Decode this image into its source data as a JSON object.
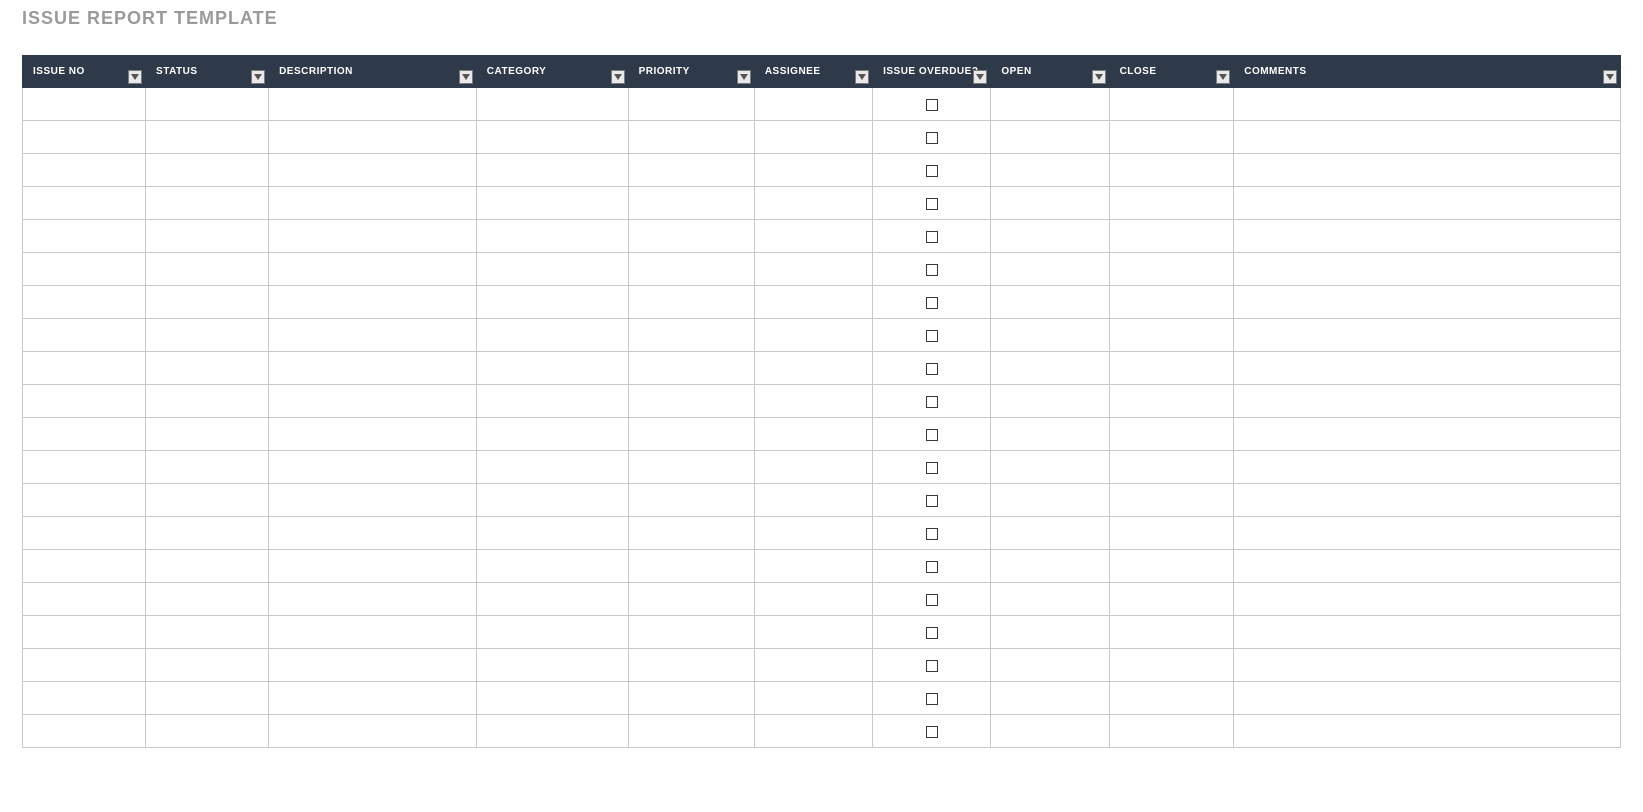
{
  "title": "ISSUE REPORT TEMPLATE",
  "columns": [
    {
      "key": "issue_no",
      "label": "ISSUE NO"
    },
    {
      "key": "status",
      "label": "STATUS"
    },
    {
      "key": "description",
      "label": "DESCRIPTION"
    },
    {
      "key": "category",
      "label": "CATEGORY"
    },
    {
      "key": "priority",
      "label": "PRIORITY"
    },
    {
      "key": "assignee",
      "label": "ASSIGNEE"
    },
    {
      "key": "overdue",
      "label": "ISSUE OVERDUE?"
    },
    {
      "key": "open",
      "label": "OPEN"
    },
    {
      "key": "close",
      "label": "CLOSE"
    },
    {
      "key": "comments",
      "label": "COMMENTS"
    }
  ],
  "rows": [
    {
      "issue_no": "",
      "status": "",
      "description": "",
      "category": "",
      "priority": "",
      "assignee": "",
      "overdue": false,
      "open": "",
      "close": "",
      "comments": ""
    },
    {
      "issue_no": "",
      "status": "",
      "description": "",
      "category": "",
      "priority": "",
      "assignee": "",
      "overdue": false,
      "open": "",
      "close": "",
      "comments": ""
    },
    {
      "issue_no": "",
      "status": "",
      "description": "",
      "category": "",
      "priority": "",
      "assignee": "",
      "overdue": false,
      "open": "",
      "close": "",
      "comments": ""
    },
    {
      "issue_no": "",
      "status": "",
      "description": "",
      "category": "",
      "priority": "",
      "assignee": "",
      "overdue": false,
      "open": "",
      "close": "",
      "comments": ""
    },
    {
      "issue_no": "",
      "status": "",
      "description": "",
      "category": "",
      "priority": "",
      "assignee": "",
      "overdue": false,
      "open": "",
      "close": "",
      "comments": ""
    },
    {
      "issue_no": "",
      "status": "",
      "description": "",
      "category": "",
      "priority": "",
      "assignee": "",
      "overdue": false,
      "open": "",
      "close": "",
      "comments": ""
    },
    {
      "issue_no": "",
      "status": "",
      "description": "",
      "category": "",
      "priority": "",
      "assignee": "",
      "overdue": false,
      "open": "",
      "close": "",
      "comments": ""
    },
    {
      "issue_no": "",
      "status": "",
      "description": "",
      "category": "",
      "priority": "",
      "assignee": "",
      "overdue": false,
      "open": "",
      "close": "",
      "comments": ""
    },
    {
      "issue_no": "",
      "status": "",
      "description": "",
      "category": "",
      "priority": "",
      "assignee": "",
      "overdue": false,
      "open": "",
      "close": "",
      "comments": ""
    },
    {
      "issue_no": "",
      "status": "",
      "description": "",
      "category": "",
      "priority": "",
      "assignee": "",
      "overdue": false,
      "open": "",
      "close": "",
      "comments": ""
    },
    {
      "issue_no": "",
      "status": "",
      "description": "",
      "category": "",
      "priority": "",
      "assignee": "",
      "overdue": false,
      "open": "",
      "close": "",
      "comments": ""
    },
    {
      "issue_no": "",
      "status": "",
      "description": "",
      "category": "",
      "priority": "",
      "assignee": "",
      "overdue": false,
      "open": "",
      "close": "",
      "comments": ""
    },
    {
      "issue_no": "",
      "status": "",
      "description": "",
      "category": "",
      "priority": "",
      "assignee": "",
      "overdue": false,
      "open": "",
      "close": "",
      "comments": ""
    },
    {
      "issue_no": "",
      "status": "",
      "description": "",
      "category": "",
      "priority": "",
      "assignee": "",
      "overdue": false,
      "open": "",
      "close": "",
      "comments": ""
    },
    {
      "issue_no": "",
      "status": "",
      "description": "",
      "category": "",
      "priority": "",
      "assignee": "",
      "overdue": false,
      "open": "",
      "close": "",
      "comments": ""
    },
    {
      "issue_no": "",
      "status": "",
      "description": "",
      "category": "",
      "priority": "",
      "assignee": "",
      "overdue": false,
      "open": "",
      "close": "",
      "comments": ""
    },
    {
      "issue_no": "",
      "status": "",
      "description": "",
      "category": "",
      "priority": "",
      "assignee": "",
      "overdue": false,
      "open": "",
      "close": "",
      "comments": ""
    },
    {
      "issue_no": "",
      "status": "",
      "description": "",
      "category": "",
      "priority": "",
      "assignee": "",
      "overdue": false,
      "open": "",
      "close": "",
      "comments": ""
    },
    {
      "issue_no": "",
      "status": "",
      "description": "",
      "category": "",
      "priority": "",
      "assignee": "",
      "overdue": false,
      "open": "",
      "close": "",
      "comments": ""
    },
    {
      "issue_no": "",
      "status": "",
      "description": "",
      "category": "",
      "priority": "",
      "assignee": "",
      "overdue": false,
      "open": "",
      "close": "",
      "comments": ""
    }
  ]
}
